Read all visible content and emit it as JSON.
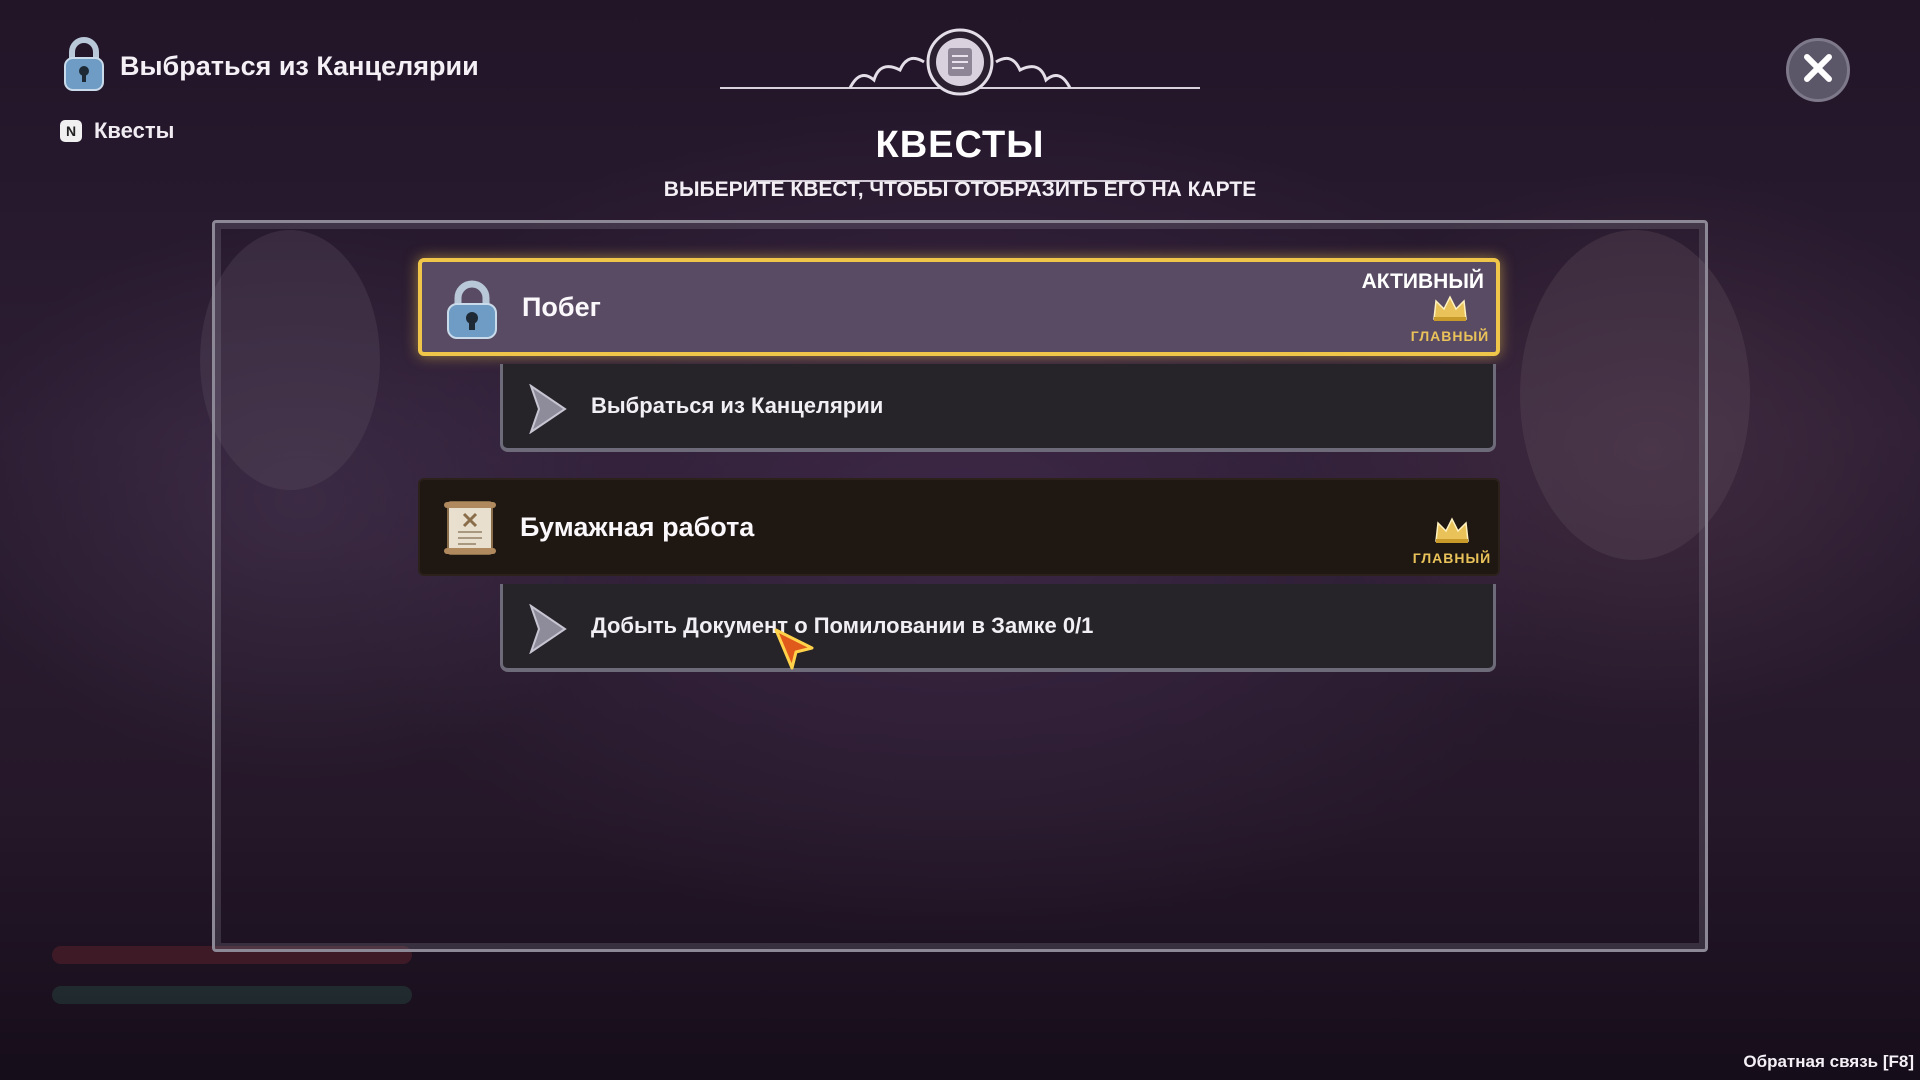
{
  "tracker": {
    "title": "Выбраться из Канцелярии",
    "icon": "padlock-icon"
  },
  "quests_hint": {
    "key": "N",
    "label": "Квесты"
  },
  "header": {
    "title": "КВЕСТЫ",
    "subtitle": "ВЫБЕРИТЕ КВЕСТ, ЧТОБЫ ОТОБРАЗИТЬ ЕГО НА КАРТЕ",
    "emblem": "scroll-emblem-icon"
  },
  "quests": [
    {
      "name": "Побег",
      "icon": "padlock-icon",
      "status": "АКТИВНЫЙ",
      "badge": "ГЛАВНЫЙ",
      "objective": "Выбраться из Канцелярии"
    },
    {
      "name": "Бумажная работа",
      "icon": "document-scroll-icon",
      "status": "",
      "badge": "ГЛАВНЫЙ",
      "objective": "Добыть Документ о Помиловании в Замке 0/1"
    }
  ],
  "footer": {
    "feedback": "Обратная связь [F8]"
  },
  "colors": {
    "active_border": "#f0c64a",
    "active_card": "#5a4b64",
    "inactive_card": "#1f1712",
    "objective_bg": "#262429",
    "badge_gold": "#e9c35a"
  }
}
